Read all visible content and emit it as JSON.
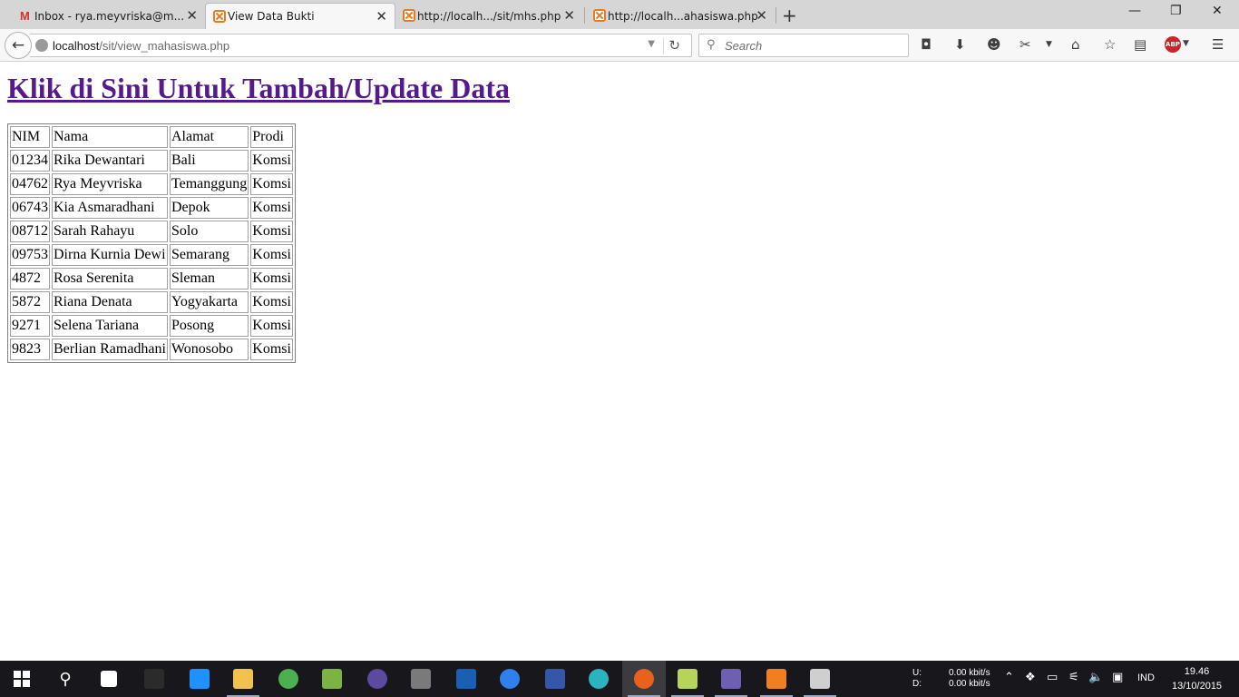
{
  "browser": {
    "tabs": [
      {
        "title": "Inbox - rya.meyvriska@m...",
        "favicon": "gmail-icon",
        "active": false
      },
      {
        "title": "View Data Bukti",
        "favicon": "xampp-icon",
        "active": true
      },
      {
        "title": "http://localh.../sit/mhs.php",
        "favicon": "xampp-icon",
        "active": false
      },
      {
        "title": "http://localh...ahasiswa.php",
        "favicon": "xampp-icon",
        "active": false
      }
    ],
    "new_tab_label": "+",
    "window_controls": {
      "minimize": "—",
      "restore": "❐",
      "close": "✕"
    },
    "url": {
      "host": "localhost",
      "path": "/sit/view_mahasiswa.php"
    },
    "search_placeholder": "Search",
    "toolbar_icons": [
      "pocket-icon",
      "download-icon",
      "smiley-icon",
      "screenshot-icon",
      "home-icon",
      "bookmark-star-icon",
      "reading-list-icon",
      "adblock-plus-icon",
      "menu-icon"
    ],
    "abp_label": "ABP"
  },
  "page": {
    "link_text": "Klik di Sini Untuk Tambah/Update Data",
    "link_color": "#551a8b",
    "table": {
      "headers": [
        "NIM",
        "Nama",
        "Alamat",
        "Prodi"
      ],
      "rows": [
        [
          "01234",
          "Rika Dewantari",
          "Bali",
          "Komsi"
        ],
        [
          "04762",
          "Rya Meyvriska",
          "Temanggung",
          "Komsi"
        ],
        [
          "06743",
          "Kia Asmaradhani",
          "Depok",
          "Komsi"
        ],
        [
          "08712",
          "Sarah Rahayu",
          "Solo",
          "Komsi"
        ],
        [
          "09753",
          "Dirna Kurnia Dewi",
          "Semarang",
          "Komsi"
        ],
        [
          "4872",
          "Rosa Serenita",
          "Sleman",
          "Komsi"
        ],
        [
          "5872",
          "Riana Denata",
          "Yogyakarta",
          "Komsi"
        ],
        [
          "9271",
          "Selena Tariana",
          "Posong",
          "Komsi"
        ],
        [
          "9823",
          "Berlian Ramadhani",
          "Wonosobo",
          "Komsi"
        ]
      ]
    }
  },
  "taskbar": {
    "apps": [
      {
        "name": "cmd-icon",
        "color": "#2b2b2b"
      },
      {
        "name": "edge-icon",
        "color": "#1e90ff"
      },
      {
        "name": "file-explorer-icon",
        "color": "#f2c14e"
      },
      {
        "name": "chrome-icon",
        "color": "#4caf50"
      },
      {
        "name": "android-studio-icon",
        "color": "#7cb342"
      },
      {
        "name": "eclipse-icon",
        "color": "#5b4aa0"
      },
      {
        "name": "sublime-text-icon",
        "color": "#7a7a7a"
      },
      {
        "name": "photoshop-icon",
        "color": "#1a5fb4"
      },
      {
        "name": "messenger-icon",
        "color": "#2f80ed"
      },
      {
        "name": "dev-cpp-icon",
        "color": "#3557a8"
      },
      {
        "name": "network-globe-icon",
        "color": "#2bb3c0"
      },
      {
        "name": "firefox-icon",
        "color": "#e8621b"
      },
      {
        "name": "notes-icon",
        "color": "#b6d35a"
      },
      {
        "name": "php-designer-icon",
        "color": "#6f5fb3"
      },
      {
        "name": "xampp-icon",
        "color": "#f07f1f"
      },
      {
        "name": "paint-icon",
        "color": "#cfcfcf"
      }
    ],
    "network_labels": "U:\nD:",
    "network_rates": "0.00 kbit/s\n0.00 kbit/s",
    "language": "IND",
    "time": "19.46",
    "date": "13/10/2015"
  }
}
